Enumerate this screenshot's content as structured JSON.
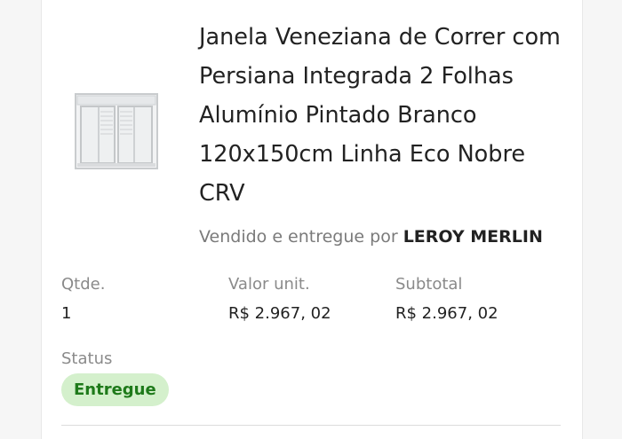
{
  "product": {
    "title": "Janela Veneziana de Correr com Persiana Integrada 2 Folhas Alumínio Pintado Branco 120x150cm Linha Eco Nobre CRV",
    "seller_prefix": "Vendido e entregue por",
    "seller_name": "LEROY MERLIN",
    "image_icon": "window-product-image"
  },
  "details": {
    "qty_label": "Qtde.",
    "qty_value": "1",
    "unit_label": "Valor unit.",
    "unit_value": "R$ 2.967, 02",
    "subtotal_label": "Subtotal",
    "subtotal_value": "R$ 2.967, 02"
  },
  "status": {
    "label": "Status",
    "value": "Entregue",
    "badge_bg": "#d4f0cc",
    "badge_fg": "#1e7a1a"
  }
}
